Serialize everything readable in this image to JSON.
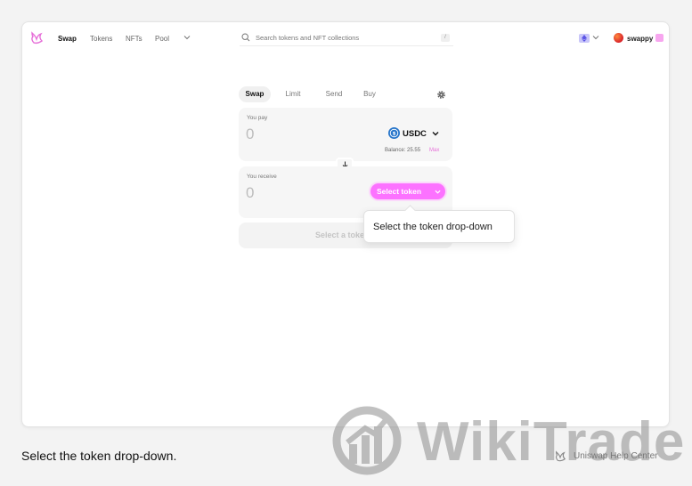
{
  "nav": {
    "links": [
      "Swap",
      "Tokens",
      "NFTs",
      "Pool"
    ],
    "search_placeholder": "Search tokens and NFT collections",
    "search_shortcut": "/",
    "user_name": "swappy"
  },
  "swap": {
    "tabs": [
      "Swap",
      "Limit",
      "Send",
      "Buy"
    ],
    "pay_label": "You pay",
    "pay_amount": "0",
    "pay_token": "USDC",
    "balance_text": "Balance: 25.55",
    "max_label": "Max",
    "receive_label": "You receive",
    "receive_amount": "0",
    "select_token_label": "Select token",
    "cta_label": "Select a token"
  },
  "tooltip": {
    "text": "Select the token drop-down"
  },
  "caption": "Select the token drop-down.",
  "help_link": "Uniswap Help Center",
  "watermark": "WikiTrade",
  "colors": {
    "accent": "#fc72ff",
    "usdc_blue": "#2775ca",
    "network": "#c9c6f9"
  },
  "icons": [
    "uniswap-logo",
    "chevron-down-icon",
    "search-icon",
    "gear-icon",
    "arrow-down-icon",
    "usdc-icon"
  ]
}
